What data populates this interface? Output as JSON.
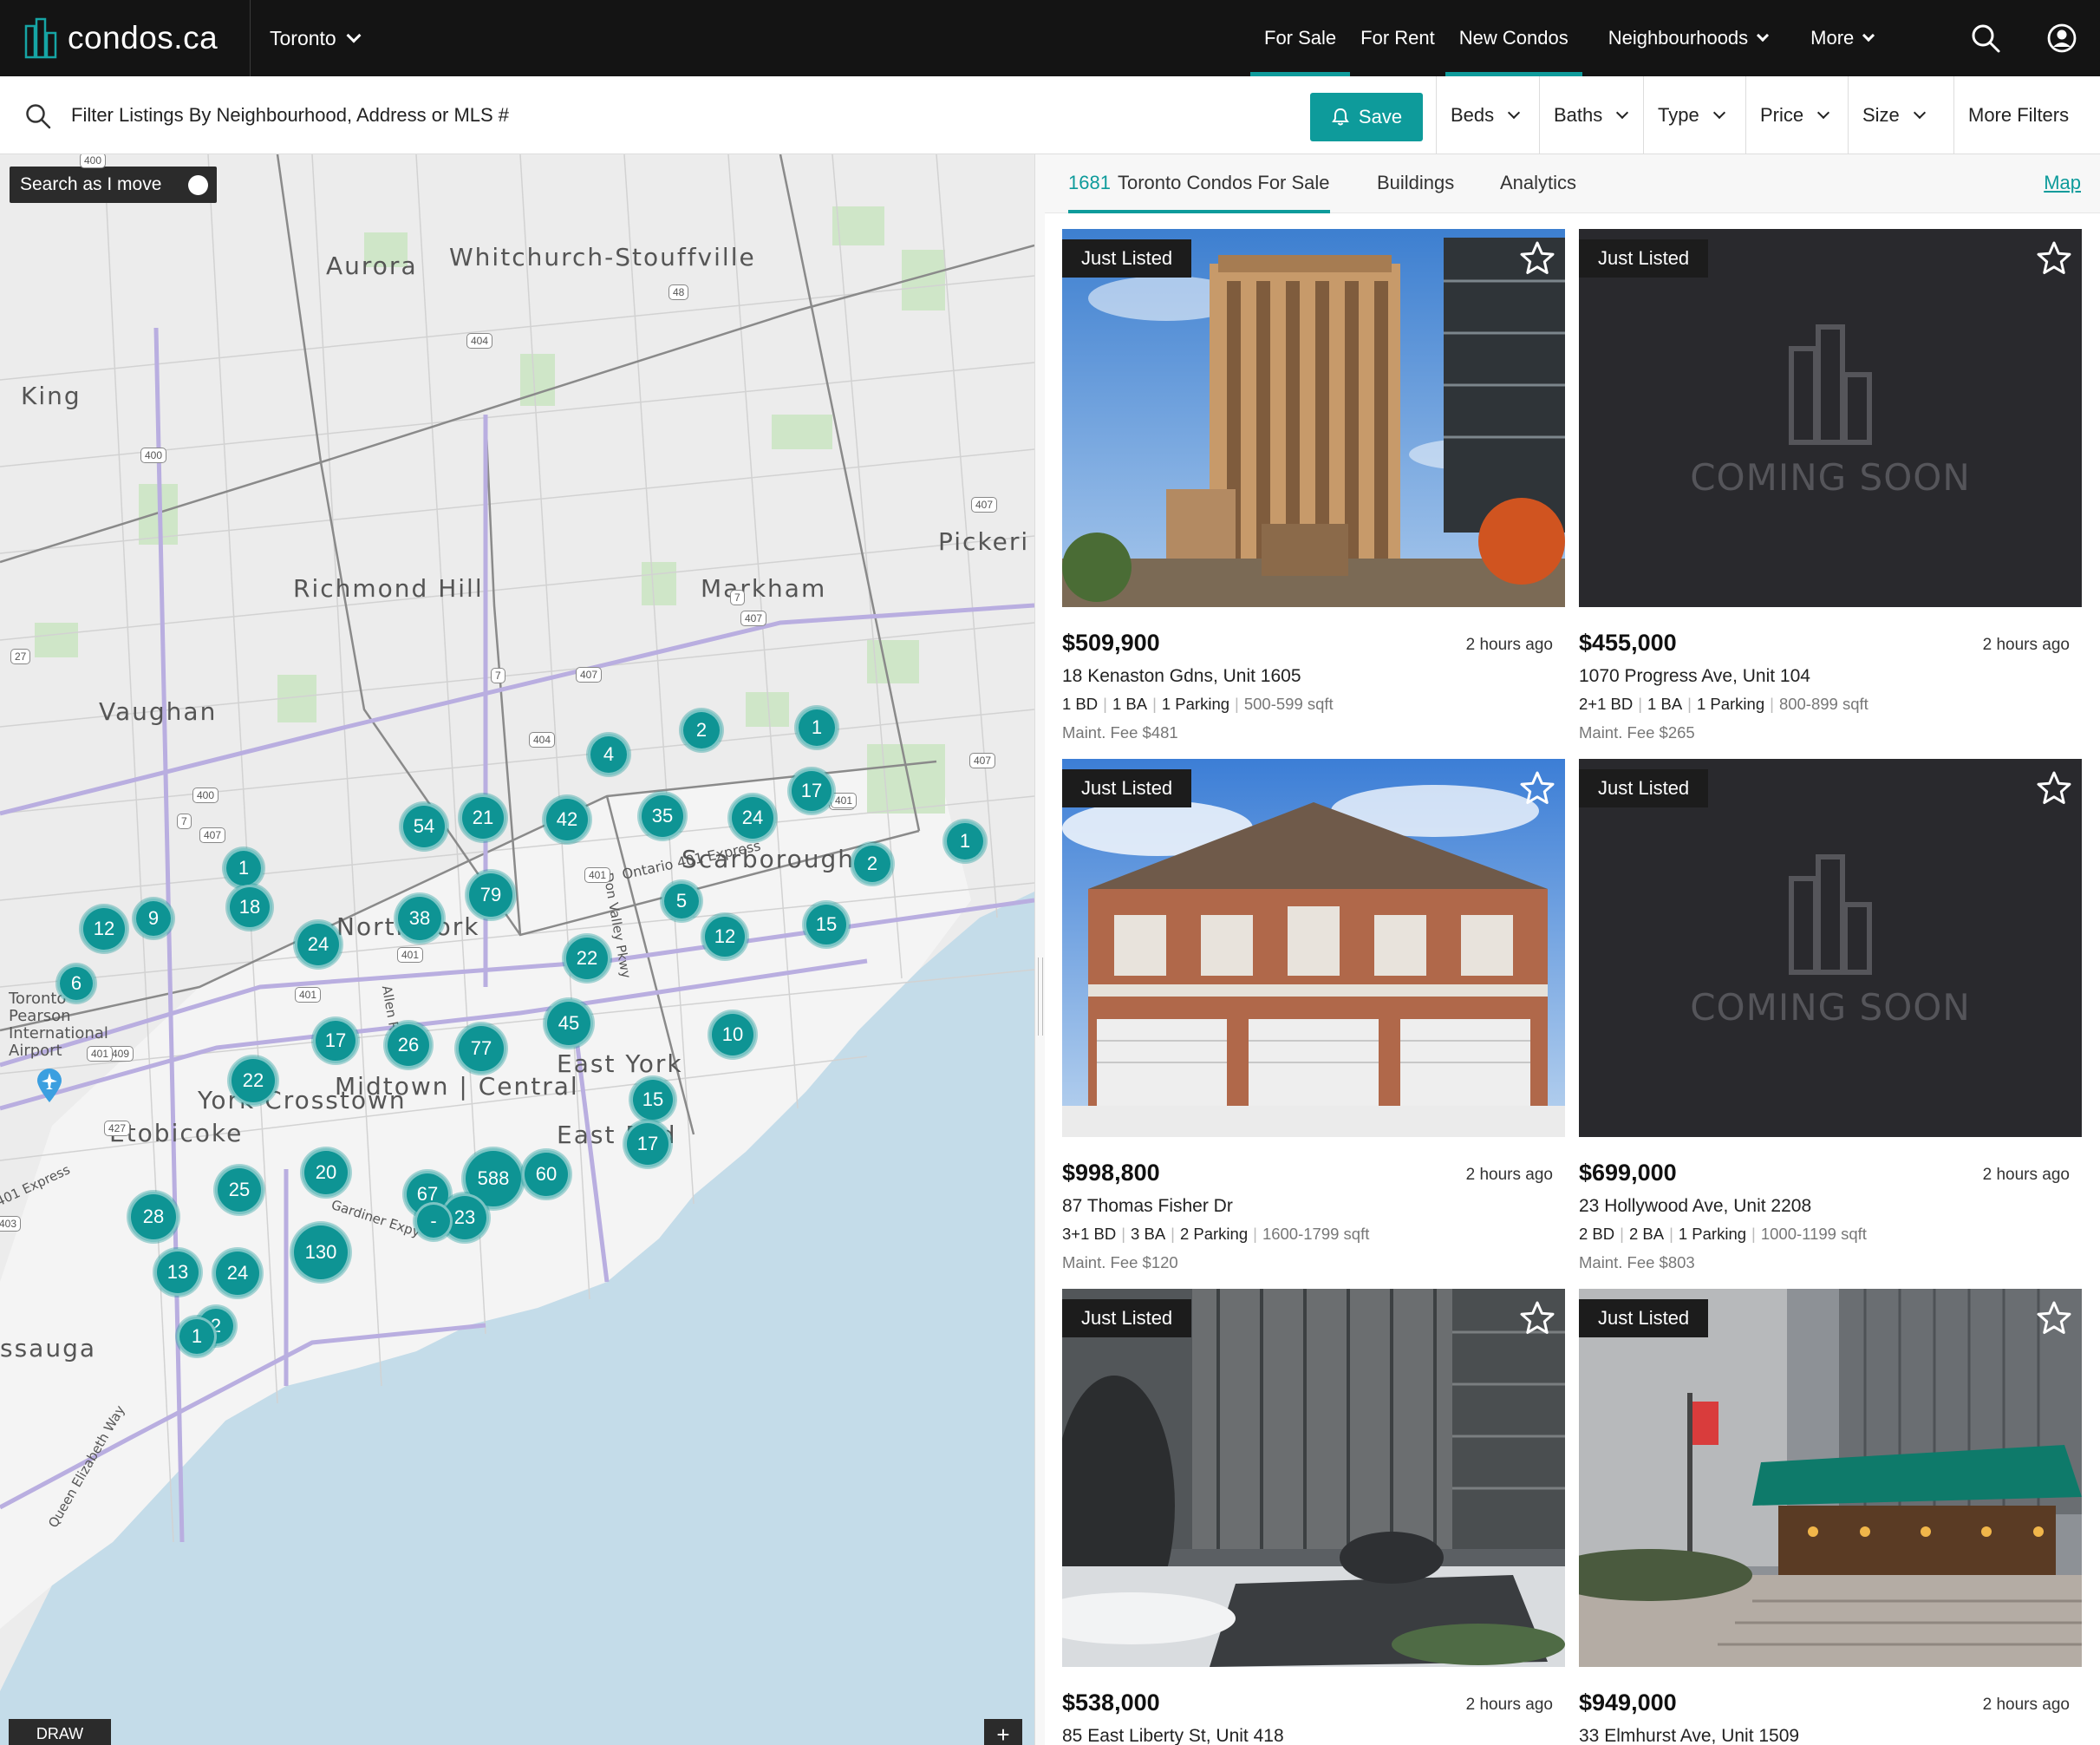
{
  "brand": {
    "name": "condos.ca",
    "accent": "#0e9b9b"
  },
  "nav": {
    "city": "Toronto",
    "links": [
      {
        "label": "For Sale",
        "active": true
      },
      {
        "label": "For Rent",
        "active": false
      },
      {
        "label": "New Condos",
        "active": true
      },
      {
        "label": "Neighbourhoods",
        "dropdown": true
      },
      {
        "label": "More",
        "dropdown": true
      }
    ],
    "icons": [
      "search-icon",
      "account-icon"
    ]
  },
  "filters": {
    "search_placeholder": "Filter Listings By Neighbourhood, Address or MLS #",
    "save_label": "Save",
    "dropdowns": [
      "Beds",
      "Baths",
      "Type",
      "Price",
      "Size"
    ],
    "more_filters": "More Filters"
  },
  "map": {
    "toggle_label": "Search as I move",
    "draw_label": "DRAW",
    "zoom_in_label": "+",
    "places": [
      "Aurora",
      "Whitchurch-Stouffville",
      "King",
      "Richmond Hill",
      "Markham",
      "Pickeri",
      "Vaughan",
      "Scarborough",
      "North York",
      "Toronto Pearson International Airport",
      "Midtown | Central",
      "York Crosstown",
      "East York",
      "East End",
      "Etobicoke",
      "ssauga"
    ],
    "road_labels": [
      "Ontario 401 Express",
      "Gardiner Expy",
      "Don Valley Pkwy",
      "Allen Rd",
      "Queen Elizabeth Way",
      "401 Express"
    ],
    "shields": [
      "400",
      "404",
      "48",
      "400",
      "407",
      "27",
      "7",
      "407",
      "404",
      "400",
      "7",
      "407",
      "401",
      "401",
      "401",
      "409",
      "427",
      "401",
      "407",
      "401",
      "7",
      "407",
      "401",
      "403"
    ],
    "clusters": [
      "2",
      "1",
      "4",
      "17",
      "1",
      "54",
      "21",
      "42",
      "35",
      "24",
      "2",
      "1",
      "1",
      "79",
      "5",
      "38",
      "18",
      "12",
      "15",
      "9",
      "24",
      "22",
      "12",
      "6",
      "17",
      "26",
      "77",
      "45",
      "10",
      "20",
      "22",
      "15",
      "17",
      "20",
      "588",
      "60",
      "25",
      "67",
      "28",
      "23",
      "-",
      "130",
      "13",
      "24",
      "2",
      "1"
    ]
  },
  "results": {
    "count": "1681",
    "tab_label": "Toronto Condos For Sale",
    "tabs": [
      "Buildings",
      "Analytics"
    ],
    "map_link": "Map",
    "coming_soon": "COMING SOON",
    "listings": [
      {
        "badge": "Just Listed",
        "price": "$509,900",
        "ago": "2 hours ago",
        "address": "18 Kenaston Gdns, Unit 1605",
        "beds": "1 BD",
        "baths": "1 BA",
        "parking": "1 Parking",
        "sqft": "500-599 sqft",
        "fee": "Maint. Fee $481",
        "photo": "tower"
      },
      {
        "badge": "Just Listed",
        "price": "$455,000",
        "ago": "2 hours ago",
        "address": "1070 Progress Ave, Unit 104",
        "beds": "2+1 BD",
        "baths": "1 BA",
        "parking": "1 Parking",
        "sqft": "800-899 sqft",
        "fee": "Maint. Fee $265",
        "photo": "coming"
      },
      {
        "badge": "Just Listed",
        "price": "$998,800",
        "ago": "2 hours ago",
        "address": "87 Thomas Fisher Dr",
        "beds": "3+1 BD",
        "baths": "3 BA",
        "parking": "2 Parking",
        "sqft": "1600-1799 sqft",
        "fee": "Maint. Fee $120",
        "photo": "townhouse"
      },
      {
        "badge": "Just Listed",
        "price": "$699,000",
        "ago": "2 hours ago",
        "address": "23 Hollywood Ave, Unit 2208",
        "beds": "2 BD",
        "baths": "2 BA",
        "parking": "1 Parking",
        "sqft": "1000-1199 sqft",
        "fee": "Maint. Fee $803",
        "photo": "coming"
      },
      {
        "badge": "Just Listed",
        "price": "$538,000",
        "ago": "2 hours ago",
        "address": "85 East Liberty St, Unit 418",
        "photo": "entrance"
      },
      {
        "badge": "Just Listed",
        "price": "$949,000",
        "ago": "2 hours ago",
        "address": "33 Elmhurst Ave, Unit 1509",
        "photo": "canopy"
      }
    ]
  }
}
